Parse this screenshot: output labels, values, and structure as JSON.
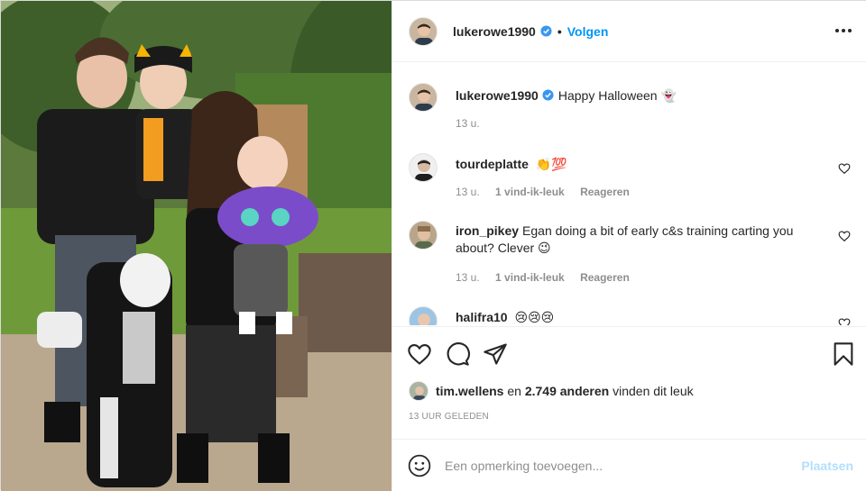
{
  "post": {
    "username": "lukerowe1990",
    "separator": "•",
    "follow_label": "Volgen",
    "more_icon": "more-options-icon",
    "verified_icon": "verified-badge-icon"
  },
  "caption": {
    "username": "lukerowe1990",
    "text": "Happy Halloween 👻",
    "time": "13 u."
  },
  "comments": [
    {
      "username": "tourdeplatte",
      "text": "👏💯",
      "time": "13 u.",
      "likes": "1 vind-ik-leuk",
      "reply": "Reageren"
    },
    {
      "username": "iron_pikey",
      "text": "Egan doing a bit of early c&s training carting you about? Clever 😉",
      "time": "13 u.",
      "likes": "1 vind-ik-leuk",
      "reply": "Reageren"
    },
    {
      "username": "halifra10",
      "text": "😢😢😢"
    }
  ],
  "actions": {
    "like_icon": "heart-icon",
    "comment_icon": "comment-icon",
    "share_icon": "share-icon",
    "save_icon": "bookmark-icon"
  },
  "likes": {
    "user": "tim.wellens",
    "middle": "en",
    "count": "2.749 anderen",
    "suffix": "vinden dit leuk"
  },
  "posted_ago": "13 UUR GELEDEN",
  "composer": {
    "placeholder": "Een opmerking toevoegen...",
    "post_label": "Plaatsen",
    "emoji_icon": "emoji-icon"
  },
  "colors": {
    "link_blue": "#0095f6",
    "post_disabled": "#b2dffc",
    "muted": "#8e8e8e",
    "text": "#262626"
  }
}
